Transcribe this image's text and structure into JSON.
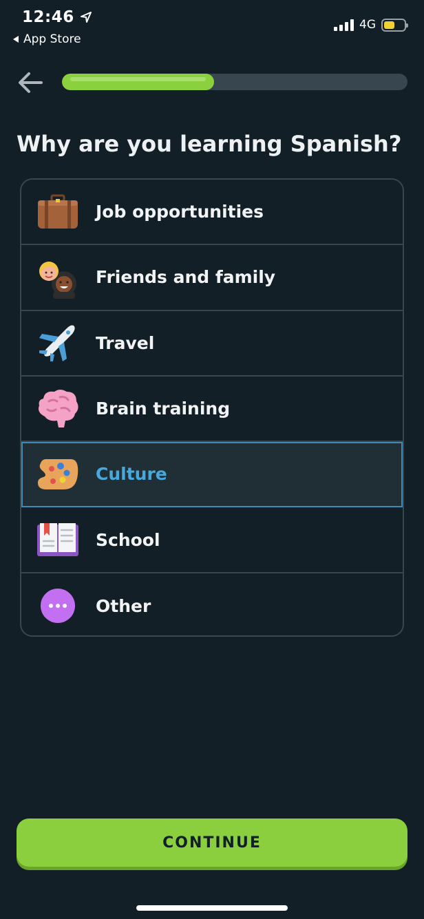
{
  "status_bar": {
    "time": "12:46",
    "back_app": "App Store",
    "network": "4G",
    "battery_level": 0.55
  },
  "header": {
    "progress": 0.44,
    "progress_color": "#8bd13d"
  },
  "question": "Why are you learning Spanish?",
  "options": [
    {
      "label": "Job opportunities",
      "icon": "briefcase-icon",
      "selected": false
    },
    {
      "label": "Friends and family",
      "icon": "friends-icon",
      "selected": false
    },
    {
      "label": "Travel",
      "icon": "airplane-icon",
      "selected": false
    },
    {
      "label": "Brain training",
      "icon": "brain-icon",
      "selected": false
    },
    {
      "label": "Culture",
      "icon": "palette-icon",
      "selected": true
    },
    {
      "label": "School",
      "icon": "book-icon",
      "selected": false
    },
    {
      "label": "Other",
      "icon": "more-dots-icon",
      "selected": false
    }
  ],
  "continue_label": "CONTINUE",
  "colors": {
    "background": "#131f27",
    "accent_green": "#8bcf3e",
    "selected_blue": "#49a8db"
  }
}
